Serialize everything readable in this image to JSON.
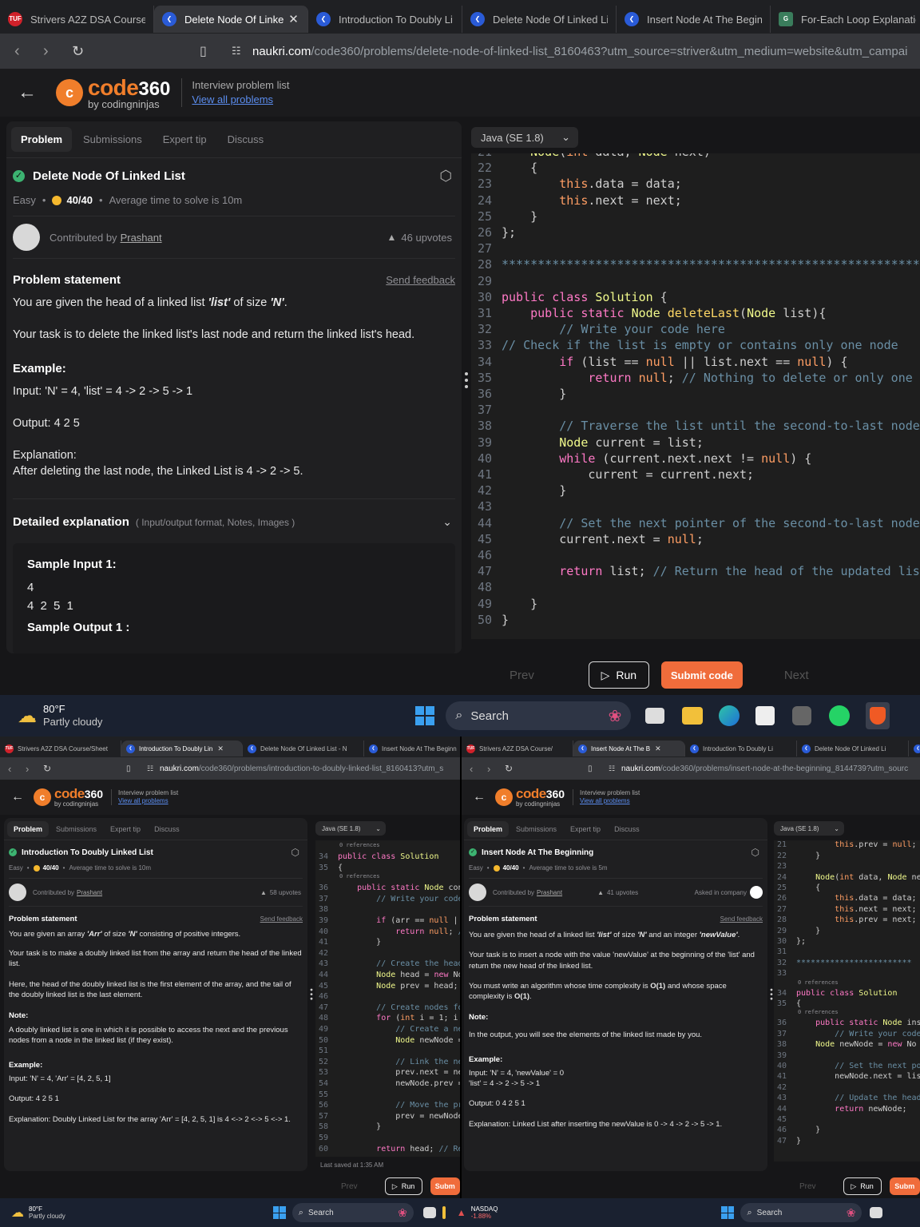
{
  "top": {
    "tabs": [
      {
        "label": "Strivers A2Z DSA Course/",
        "icon": "TUF",
        "kind": "red"
      },
      {
        "label": "Delete Node Of Linke",
        "icon": "C",
        "kind": "blue",
        "active": true
      },
      {
        "label": "Introduction To Doubly Li",
        "icon": "C",
        "kind": "blue"
      },
      {
        "label": "Delete Node Of Linked Li",
        "icon": "C",
        "kind": "blue"
      },
      {
        "label": "Insert Node At The Beginn",
        "icon": "C",
        "kind": "blue"
      },
      {
        "label": "For-Each Loop Explanatio",
        "icon": "G",
        "kind": "green"
      }
    ],
    "url_host": "naukri.com",
    "url_path": "/code360/problems/delete-node-of-linked-list_8160463?utm_source=striver&utm_medium=website&utm_campai",
    "logo_code": "code",
    "logo_360": "360",
    "logo_sub": "by codingninjas",
    "ipl_title": "Interview problem list",
    "ipl_link": "View all problems",
    "ptabs": [
      "Problem",
      "Submissions",
      "Expert tip",
      "Discuss"
    ],
    "title": "Delete Node Of Linked List",
    "difficulty": "Easy",
    "score": "40/40",
    "avg_time": "Average time to solve is 10m",
    "contributed_by": "Contributed by",
    "author": "Prashant",
    "upvotes": "46 upvotes",
    "ps_heading": "Problem statement",
    "send_feedback": "Send feedback",
    "p1_a": "You are given the head of a linked list ",
    "p1_b": "'list'",
    "p1_c": " of size ",
    "p1_d": "'N'",
    "p1_e": ".",
    "p2": "Your task is to delete the linked list's last node and return the linked list's head.",
    "example_h": "Example:",
    "ex_input": "Input: 'N' = 4, 'list' = 4 -> 2 -> 5 -> 1",
    "ex_output": "Output: 4 2 5",
    "ex_expl_h": "Explanation:",
    "ex_expl": "After deleting the last node, the Linked List is 4 -> 2 -> 5.",
    "detailed": "Detailed explanation",
    "detailed_sub": "( Input/output format, Notes, Images )",
    "sample_in_h": "Sample Input 1:",
    "sample_in_1": "4",
    "sample_in_2": "4 2 5 1",
    "sample_out_h": "Sample Output 1 :",
    "lang": "Java (SE 1.8)",
    "code": [
      {
        "n": "21",
        "t": "    Node(int data, Node next)"
      },
      {
        "n": "22",
        "t": "    {"
      },
      {
        "n": "23",
        "t": "        this.data = data;"
      },
      {
        "n": "24",
        "t": "        this.next = next;"
      },
      {
        "n": "25",
        "t": "    }"
      },
      {
        "n": "26",
        "t": "};"
      },
      {
        "n": "27",
        "t": ""
      },
      {
        "n": "28",
        "t": "*****************************************************************"
      },
      {
        "n": "29",
        "t": ""
      },
      {
        "n": "30",
        "t": "public class Solution {"
      },
      {
        "n": "31",
        "t": "    public static Node deleteLast(Node list){"
      },
      {
        "n": "32",
        "t": "        // Write your code here"
      },
      {
        "n": "33",
        "t": "// Check if the list is empty or contains only one node"
      },
      {
        "n": "34",
        "t": "        if (list == null || list.next == null) {"
      },
      {
        "n": "35",
        "t": "            return null; // Nothing to delete or only one node, retu"
      },
      {
        "n": "36",
        "t": "        }"
      },
      {
        "n": "37",
        "t": ""
      },
      {
        "n": "38",
        "t": "        // Traverse the list until the second-to-last node"
      },
      {
        "n": "39",
        "t": "        Node current = list;"
      },
      {
        "n": "40",
        "t": "        while (current.next.next != null) {"
      },
      {
        "n": "41",
        "t": "            current = current.next;"
      },
      {
        "n": "42",
        "t": "        }"
      },
      {
        "n": "43",
        "t": ""
      },
      {
        "n": "44",
        "t": "        // Set the next pointer of the second-to-last node to null"
      },
      {
        "n": "45",
        "t": "        current.next = null;"
      },
      {
        "n": "46",
        "t": ""
      },
      {
        "n": "47",
        "t": "        return list; // Return the head of the updated list"
      },
      {
        "n": "48",
        "t": ""
      },
      {
        "n": "49",
        "t": "    }"
      },
      {
        "n": "50",
        "t": "}"
      }
    ],
    "prev": "Prev",
    "run": "Run",
    "submit": "Submit code",
    "next": "Next"
  },
  "taskbar": {
    "temp": "80°F",
    "weather": "Partly cloudy",
    "search": "Search"
  },
  "bl": {
    "tabs": [
      {
        "label": "Strivers A2Z DSA Course/Sheet",
        "icon": "TUF",
        "kind": "red"
      },
      {
        "label": "Introduction To Doubly Lin",
        "icon": "C",
        "kind": "blue",
        "active": true
      },
      {
        "label": "Delete Node Of Linked List - N",
        "icon": "C",
        "kind": "blue"
      },
      {
        "label": "Insert Node At The Beginn",
        "icon": "C",
        "kind": "blue"
      }
    ],
    "url_host": "naukri.com",
    "url_path": "/code360/problems/introduction-to-doubly-linked-list_8160413?utm_s",
    "logo_code": "code",
    "logo_360": "360",
    "logo_sub": "by codingninjas",
    "ipl_title": "Interview problem list",
    "ipl_link": "View all problems",
    "ptabs": [
      "Problem",
      "Submissions",
      "Expert tip",
      "Discuss"
    ],
    "title": "Introduction To Doubly Linked List",
    "difficulty": "Easy",
    "score": "40/40",
    "avg_time": "Average time to solve is 10m",
    "contributed_by": "Contributed by",
    "author": "Prashant",
    "upvotes": "58 upvotes",
    "ps_heading": "Problem statement",
    "send_feedback": "Send feedback",
    "p1_a": "You are given an array ",
    "p1_b": "'Arr'",
    "p1_c": " of size ",
    "p1_d": "'N'",
    "p1_e": " consisting of positive integers.",
    "p2": "Your task is to make a doubly linked list from the array and return the head of the linked list.",
    "p3": "Here, the head of the doubly linked list is the first element of the array, and the tail of the doubly linked list is the last element.",
    "note_h": "Note:",
    "note": "A doubly linked list is one in which it is possible to access the next and the previous nodes from a node in the linked list (if they exist).",
    "example_h": "Example:",
    "ex_input": "Input: 'N' = 4, 'Arr' = [4, 2, 5, 1]",
    "ex_output": "Output: 4 2 5 1",
    "ex_expl": "Explanation: Doubly Linked List for the array 'Arr' = [4, 2, 5, 1] is 4 <-> 2 <-> 5 <-> 1.",
    "lang": "Java (SE 1.8)",
    "refs": "0 references",
    "code": [
      {
        "n": "34",
        "t": "public class Solution",
        "r": true
      },
      {
        "n": "35",
        "t": "{"
      },
      {
        "n": "36",
        "t": "    public static Node const",
        "r": true
      },
      {
        "n": "37",
        "t": "        // Write your code her"
      },
      {
        "n": "38",
        "t": ""
      },
      {
        "n": "39",
        "t": "        if (arr == null || arr.le"
      },
      {
        "n": "40",
        "t": "            return null; // Retur"
      },
      {
        "n": "41",
        "t": "        }"
      },
      {
        "n": "42",
        "t": ""
      },
      {
        "n": "43",
        "t": "        // Create the head noc"
      },
      {
        "n": "44",
        "t": "        Node head = new Nod"
      },
      {
        "n": "45",
        "t": "        Node prev = head; // l"
      },
      {
        "n": "46",
        "t": ""
      },
      {
        "n": "47",
        "t": "        // Create nodes for the"
      },
      {
        "n": "48",
        "t": "        for (int i = 1; i < arr.le"
      },
      {
        "n": "49",
        "t": "            // Create a new noc"
      },
      {
        "n": "50",
        "t": "            Node newNode = n"
      },
      {
        "n": "51",
        "t": ""
      },
      {
        "n": "52",
        "t": "            // Link the new nod"
      },
      {
        "n": "53",
        "t": "            prev.next = newNod"
      },
      {
        "n": "54",
        "t": "            newNode.prev = pr"
      },
      {
        "n": "55",
        "t": ""
      },
      {
        "n": "56",
        "t": "            // Move the previou"
      },
      {
        "n": "57",
        "t": "            prev = newNode;"
      },
      {
        "n": "58",
        "t": "        }"
      },
      {
        "n": "59",
        "t": ""
      },
      {
        "n": "60",
        "t": "        return head; // Return"
      }
    ],
    "saved": "Last saved at 1:35 AM",
    "prev": "Prev",
    "run": "Run",
    "submit": "Subm",
    "temp": "80°F",
    "weather": "Partly cloudy",
    "search": "Search"
  },
  "br": {
    "tabs": [
      {
        "label": "Strivers A2Z DSA Course/",
        "icon": "TUF",
        "kind": "red"
      },
      {
        "label": "Insert Node At The B",
        "icon": "C",
        "kind": "blue",
        "active": true
      },
      {
        "label": "Introduction To Doubly Li",
        "icon": "C",
        "kind": "blue"
      },
      {
        "label": "Delete Node Of Linked Li",
        "icon": "C",
        "kind": "blue"
      },
      {
        "label": "Insert No",
        "icon": "C",
        "kind": "blue"
      }
    ],
    "url_host": "naukri.com",
    "url_path": "/code360/problems/insert-node-at-the-beginning_8144739?utm_sourc",
    "logo_code": "code",
    "logo_360": "360",
    "logo_sub": "by codingninjas",
    "ipl_title": "Interview problem list",
    "ipl_link": "View all problems",
    "ptabs": [
      "Problem",
      "Submissions",
      "Expert tip",
      "Discuss"
    ],
    "title": "Insert Node At The Beginning",
    "difficulty": "Easy",
    "score": "40/40",
    "avg_time": "Average time to solve is 5m",
    "contributed_by": "Contributed by",
    "author": "Prashant",
    "upvotes": "41 upvotes",
    "asked": "Asked in company",
    "ps_heading": "Problem statement",
    "send_feedback": "Send feedback",
    "p1_a": "You are given the head of a linked list ",
    "p1_b": "'list'",
    "p1_c": " of size ",
    "p1_d": "'N'",
    "p1_e": " and an integer ",
    "p1_f": "'newValue'",
    "p1_g": ".",
    "p2": "Your task is to insert a node with the value 'newValue' at the beginning of the 'list' and return the new head of the linked list.",
    "p3_a": "You must write an algorithm whose time complexity is ",
    "p3_b": "O(1)",
    "p3_c": " and whose space complexity is ",
    "p3_d": "O(1)",
    "p3_e": ".",
    "note_h": "Note:",
    "note": "In the output, you will see the elements of the linked list made by you.",
    "example_h": "Example:",
    "ex_input": "Input: 'N' = 4, 'newValue' = 0",
    "ex_input2": "'list' = 4 -> 2 -> 5 -> 1",
    "ex_output": "Output: 0 4 2 5 1",
    "ex_expl": "Explanation: Linked List after inserting the newValue is 0 -> 4 -> 2 -> 5 -> 1.",
    "lang": "Java (SE 1.8)",
    "refs": "0 references",
    "code": [
      {
        "n": "20",
        "t": "        this.next = null;"
      },
      {
        "n": "21",
        "t": "        this.prev = null;"
      },
      {
        "n": "22",
        "t": "    }"
      },
      {
        "n": "23",
        "t": ""
      },
      {
        "n": "24",
        "t": "    Node(int data, Node ne"
      },
      {
        "n": "25",
        "t": "    {"
      },
      {
        "n": "26",
        "t": "        this.data = data;"
      },
      {
        "n": "27",
        "t": "        this.next = next;"
      },
      {
        "n": "28",
        "t": "        this.prev = next;"
      },
      {
        "n": "29",
        "t": "    }"
      },
      {
        "n": "30",
        "t": "};"
      },
      {
        "n": "31",
        "t": ""
      },
      {
        "n": "32",
        "t": "************************"
      },
      {
        "n": "33",
        "t": ""
      },
      {
        "n": "34",
        "t": "public class Solution",
        "r": true
      },
      {
        "n": "35",
        "t": "{"
      },
      {
        "n": "36",
        "t": "    public static Node insert",
        "r": true
      },
      {
        "n": "37",
        "t": "        // Write your code her"
      },
      {
        "n": "38",
        "t": "    Node newNode = new No"
      },
      {
        "n": "39",
        "t": ""
      },
      {
        "n": "40",
        "t": "        // Set the next pointer"
      },
      {
        "n": "41",
        "t": "        newNode.next = list;"
      },
      {
        "n": "42",
        "t": ""
      },
      {
        "n": "43",
        "t": "        // Update the head of"
      },
      {
        "n": "44",
        "t": "        return newNode;"
      },
      {
        "n": "45",
        "t": ""
      },
      {
        "n": "46",
        "t": "    }"
      },
      {
        "n": "47",
        "t": "}"
      }
    ],
    "prev": "Prev",
    "run": "Run",
    "submit": "Subm",
    "ticker": "NASDAQ",
    "ticker_val": "-1.88%",
    "search": "Search"
  }
}
